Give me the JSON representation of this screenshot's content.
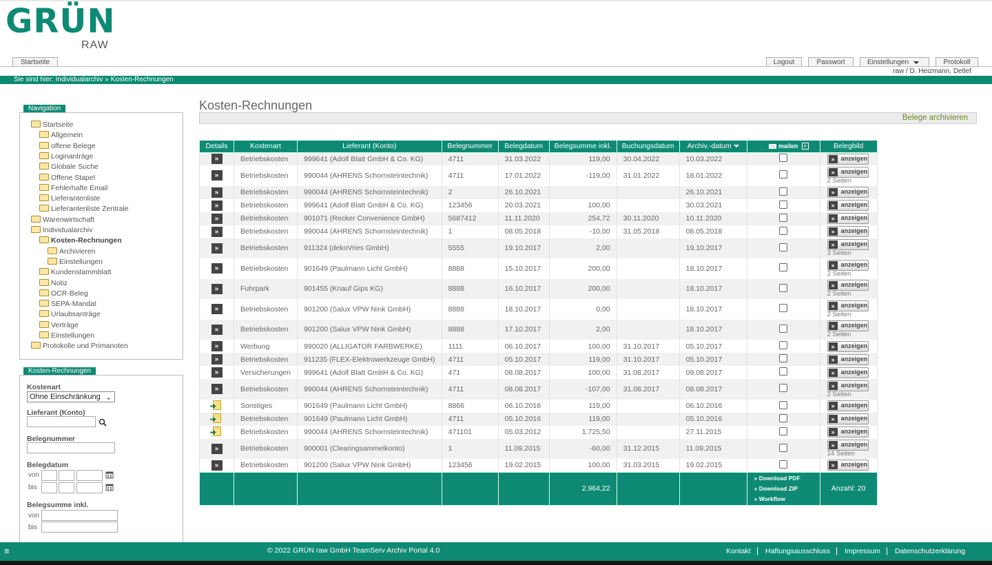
{
  "brand": {
    "name": "GRÜN",
    "sub": "RAW"
  },
  "tabs": {
    "home": "Startseite",
    "logout": "Logout",
    "password": "Passwort",
    "settings": "Einstellungen",
    "protocol": "Protokoll"
  },
  "user": "raw / D. Heizmann, Detlef",
  "breadcrumb": "Sie sind hier: Individualarchiv » Kosten-Rechnungen",
  "navigation": {
    "title": "Navigation",
    "items": [
      {
        "label": "Startseite",
        "level": 0
      },
      {
        "label": "Allgemein",
        "level": 1
      },
      {
        "label": "offene Belege",
        "level": 1
      },
      {
        "label": "Loginanträge",
        "level": 1
      },
      {
        "label": "Globale Suche",
        "level": 1
      },
      {
        "label": "Offene Stapel",
        "level": 1
      },
      {
        "label": "Fehlerhafte Email",
        "level": 1
      },
      {
        "label": "Lieferantenliste",
        "level": 1
      },
      {
        "label": "Lieferantenliste Zentrale",
        "level": 1
      },
      {
        "label": "Warenwirtschaft",
        "level": 0
      },
      {
        "label": "Individualarchiv",
        "level": 0
      },
      {
        "label": "Kosten-Rechnungen",
        "level": 1,
        "current": true
      },
      {
        "label": "Archivieren",
        "level": 2
      },
      {
        "label": "Einstellungen",
        "level": 2
      },
      {
        "label": "Kundenstammblatt",
        "level": 1
      },
      {
        "label": "Notiz",
        "level": 1
      },
      {
        "label": "OCR-Beleg",
        "level": 1
      },
      {
        "label": "SEPA-Mandat",
        "level": 1
      },
      {
        "label": "Urlaubsanträge",
        "level": 1
      },
      {
        "label": "Verträge",
        "level": 1
      },
      {
        "label": "Einstellungen",
        "level": 1
      },
      {
        "label": "Protokolle und Primanoten",
        "level": 0
      }
    ]
  },
  "filter": {
    "title": "Kosten-Rechnungen",
    "kostenart_label": "Kostenart",
    "kostenart_value": "Ohne Einschränkung",
    "lieferant_label": "Lieferant (Konto)",
    "belegnummer_label": "Belegnummer",
    "belegdatum_label": "Belegdatum",
    "from": "von",
    "to": "bis",
    "belegsumme_label": "Belegsumme inkl."
  },
  "main": {
    "title": "Kosten-Rechnungen",
    "archive_link": "Belege archivieren"
  },
  "table": {
    "headers": [
      "Details",
      "Kostenart",
      "Lieferant (Konto)",
      "Belegnummer",
      "Belegdatum",
      "Belegsumme inkl.",
      "Buchungsdatum",
      "Archiv.-datum",
      "mailen",
      "Belegbild"
    ],
    "view_label": "anzeigen",
    "rows": [
      {
        "icon": "arrow",
        "kostenart": "Betriebskosten",
        "lieferant": "999641 (Adolf Blatt GmbH & Co. KG)",
        "belegnr": "4711",
        "belegdatum": "31.03.2022",
        "summe": "119,00",
        "buchung": "30.04.2022",
        "archiv": "10.03.2022",
        "seiten": ""
      },
      {
        "icon": "arrow",
        "kostenart": "Betriebskosten",
        "lieferant": "990044 (AHRENS Schornsteintechnik)",
        "belegnr": "4711",
        "belegdatum": "17.01.2022",
        "summe": "-119,00",
        "buchung": "31.01.2022",
        "archiv": "18.01.2022",
        "seiten": "2 Seiten"
      },
      {
        "icon": "arrow",
        "kostenart": "Betriebskosten",
        "lieferant": "990044 (AHRENS Schornsteintechnik)",
        "belegnr": "2",
        "belegdatum": "26.10.2021",
        "summe": "",
        "buchung": "",
        "archiv": "26.10.2021",
        "seiten": ""
      },
      {
        "icon": "arrow",
        "kostenart": "Betriebskosten",
        "lieferant": "999641 (Adolf Blatt GmbH & Co. KG)",
        "belegnr": "123456",
        "belegdatum": "20.03.2021",
        "summe": "100,00",
        "buchung": "",
        "archiv": "30.03.2021",
        "seiten": ""
      },
      {
        "icon": "arrow",
        "kostenart": "Betriebskosten",
        "lieferant": "901071 (Recker Convenience GmbH)",
        "belegnr": "5687412",
        "belegdatum": "11.11.2020",
        "summe": "254,72",
        "buchung": "30.11.2020",
        "archiv": "10.11.2020",
        "seiten": ""
      },
      {
        "icon": "arrow",
        "kostenart": "Betriebskosten",
        "lieferant": "990044 (AHRENS Schornsteintechnik)",
        "belegnr": "1",
        "belegdatum": "08.05.2018",
        "summe": "-10,00",
        "buchung": "31.05.2018",
        "archiv": "08.05.2018",
        "seiten": ""
      },
      {
        "icon": "arrow",
        "kostenart": "Betriebskosten",
        "lieferant": "911324 (dekoVries GmbH)",
        "belegnr": "5555",
        "belegdatum": "19.10.2017",
        "summe": "2,00",
        "buchung": "",
        "archiv": "19.10.2017",
        "seiten": "3 Seiten"
      },
      {
        "icon": "arrow",
        "kostenart": "Betriebskosten",
        "lieferant": "901649 (Paulmann Licht GmbH)",
        "belegnr": "8888",
        "belegdatum": "15.10.2017",
        "summe": "200,00",
        "buchung": "",
        "archiv": "18.10.2017",
        "seiten": "2 Seiten"
      },
      {
        "icon": "arrow",
        "kostenart": "Fuhrpark",
        "lieferant": "901455 (Knauf Gips KG)",
        "belegnr": "8888",
        "belegdatum": "16.10.2017",
        "summe": "200,00",
        "buchung": "",
        "archiv": "18.10.2017",
        "seiten": "2 Seiten"
      },
      {
        "icon": "arrow",
        "kostenart": "Betriebskosten",
        "lieferant": "901200 (Salux VPW Nink GmbH)",
        "belegnr": "8888",
        "belegdatum": "18.10.2017",
        "summe": "0,00",
        "buchung": "",
        "archiv": "18.10.2017",
        "seiten": "2 Seiten"
      },
      {
        "icon": "arrow",
        "kostenart": "Betriebskosten",
        "lieferant": "901200 (Salux VPW Nink GmbH)",
        "belegnr": "8888",
        "belegdatum": "17.10.2017",
        "summe": "2,00",
        "buchung": "",
        "archiv": "18.10.2017",
        "seiten": "2 Seiten"
      },
      {
        "icon": "arrow",
        "kostenart": "Werbung",
        "lieferant": "990020 (ALLIGATOR FARBWERKE)",
        "belegnr": "1111",
        "belegdatum": "06.10.2017",
        "summe": "100,00",
        "buchung": "31.10.2017",
        "archiv": "05.10.2017",
        "seiten": ""
      },
      {
        "icon": "arrow",
        "kostenart": "Betriebskosten",
        "lieferant": "911235 (FLEX-Elektrowerkzeuge GmbH)",
        "belegnr": "4711",
        "belegdatum": "05.10.2017",
        "summe": "119,00",
        "buchung": "31.10.2017",
        "archiv": "05.10.2017",
        "seiten": ""
      },
      {
        "icon": "arrow",
        "kostenart": "Versicherungen",
        "lieferant": "999641 (Adolf Blatt GmbH & Co. KG)",
        "belegnr": "471",
        "belegdatum": "08.08.2017",
        "summe": "100,00",
        "buchung": "31.08.2017",
        "archiv": "09.08.2017",
        "seiten": ""
      },
      {
        "icon": "arrow",
        "kostenart": "Betriebskosten",
        "lieferant": "990044 (AHRENS Schornsteintechnik)",
        "belegnr": "4711",
        "belegdatum": "08.08.2017",
        "summe": "-107,00",
        "buchung": "31.08.2017",
        "archiv": "08.08.2017",
        "seiten": "2 Seiten"
      },
      {
        "icon": "doc",
        "kostenart": "Sonstiges",
        "lieferant": "901649 (Paulmann Licht GmbH)",
        "belegnr": "8866",
        "belegdatum": "06.10.2016",
        "summe": "119,00",
        "buchung": "",
        "archiv": "06.10.2016",
        "seiten": ""
      },
      {
        "icon": "doc",
        "kostenart": "Betriebskosten",
        "lieferant": "901649 (Paulmann Licht GmbH)",
        "belegnr": "4711",
        "belegdatum": "05.10.2016",
        "summe": "119,00",
        "buchung": "",
        "archiv": "05.10.2016",
        "seiten": ""
      },
      {
        "icon": "doc",
        "kostenart": "Betriebskosten",
        "lieferant": "990044 (AHRENS Schornsteintechnik)",
        "belegnr": "471101",
        "belegdatum": "05.03.2012",
        "summe": "1.725,50",
        "buchung": "",
        "archiv": "27.11.2015",
        "seiten": ""
      },
      {
        "icon": "arrow",
        "kostenart": "Betriebskosten",
        "lieferant": "900001 (Clearingsammelkonto)",
        "belegnr": "1",
        "belegdatum": "11.09.2015",
        "summe": "-60,00",
        "buchung": "31.12.2015",
        "archiv": "11.09.2015",
        "seiten": "14 Seiten"
      },
      {
        "icon": "arrow",
        "kostenart": "Betriebskosten",
        "lieferant": "901200 (Salux VPW Nink GmbH)",
        "belegnr": "123456",
        "belegdatum": "19.02.2015",
        "summe": "100,00",
        "buchung": "31.03.2015",
        "archiv": "19.02.2015",
        "seiten": ""
      }
    ],
    "footer": {
      "total": "2.964,22",
      "download_pdf": "Download PDF",
      "download_zip": "Download ZIP",
      "workflow": "Workflow",
      "count": "Anzahl: 20"
    }
  },
  "footer": {
    "copyright": "© 2022 GRÜN raw GmbH TeamServ Archiv Portal 4.0",
    "links": [
      "Kontakt",
      "Haftungsausschluss",
      "Impressum",
      "Datenschutzerklärung"
    ]
  },
  "colors": {
    "brand": "#0e8a74",
    "link_green": "#6a8a1e"
  }
}
